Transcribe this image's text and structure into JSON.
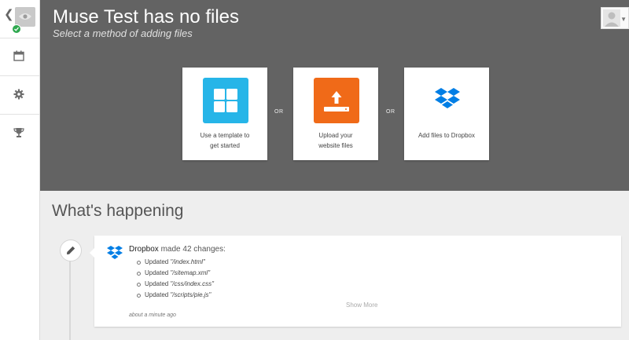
{
  "header": {
    "title": "Muse Test has no files",
    "subtitle": "Select a method of adding files"
  },
  "sidebar": {
    "items": [
      {
        "name": "calendar-icon"
      },
      {
        "name": "gear-icon"
      },
      {
        "name": "trophy-icon"
      }
    ]
  },
  "add_options": {
    "template": {
      "line1": "Use a template to",
      "line2": "get started",
      "icon": "grid-icon"
    },
    "upload": {
      "line1": "Upload your",
      "line2": "website files",
      "icon": "upload-icon"
    },
    "dropbox": {
      "line1": "Add files to Dropbox",
      "icon": "dropbox-icon"
    },
    "separator": "OR"
  },
  "activity": {
    "title": "What's happening",
    "event": {
      "source": "Dropbox",
      "summary": " made 42 changes:",
      "changes": [
        {
          "prefix": "Updated ",
          "path": "\"/index.html\""
        },
        {
          "prefix": "Updated ",
          "path": "\"/sitemap.xml\""
        },
        {
          "prefix": "Updated ",
          "path": "\"/css/index.css\""
        },
        {
          "prefix": "Updated ",
          "path": "\"/scripts/pie.js\""
        }
      ],
      "show_more": "Show More",
      "time": "about a minute ago"
    }
  },
  "colors": {
    "header_bg": "#636363",
    "template_tile": "#26b5e8",
    "upload_tile": "#f06a18",
    "dropbox_blue": "#007ee5",
    "status_green": "#2fa84f"
  }
}
